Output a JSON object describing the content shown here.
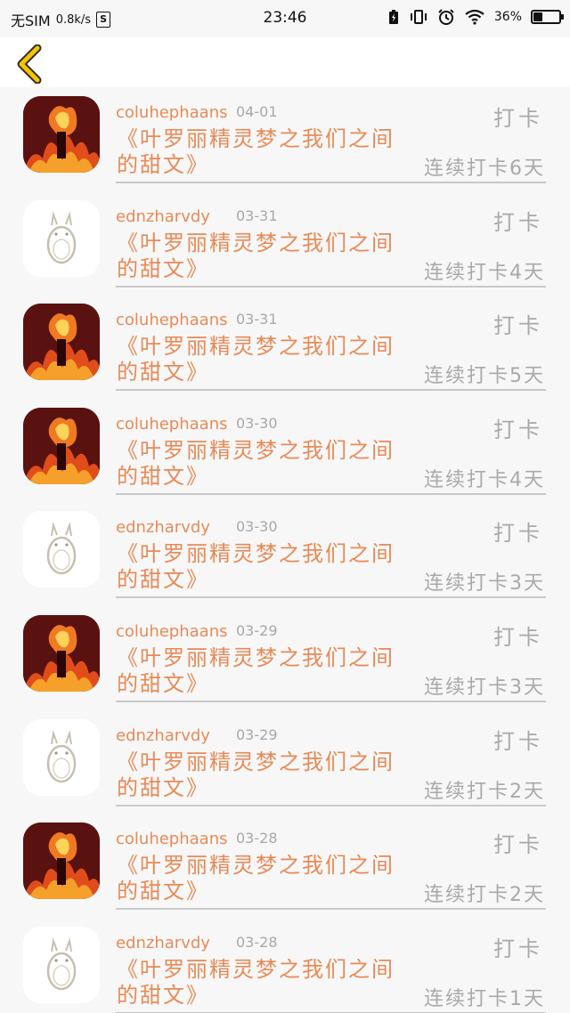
{
  "status_bar": {
    "carrier": "无SIM",
    "net_speed": "0.8k/s",
    "sim_badge": "S",
    "time": "23:46",
    "battery_text": "36%",
    "battery_level": 0.36
  },
  "nav": {
    "back_icon": "chevron-left-icon"
  },
  "feed": [
    {
      "avatar": "fire",
      "user": "coluhephaans",
      "date": "04-01",
      "title": "《叶罗丽精灵梦之我们之间的甜文》",
      "action": "打卡",
      "streak": "连续打卡6天"
    },
    {
      "avatar": "totoro",
      "user": "ednzharvdy",
      "date": "03-31",
      "title": "《叶罗丽精灵梦之我们之间的甜文》",
      "action": "打卡",
      "streak": "连续打卡4天"
    },
    {
      "avatar": "fire",
      "user": "coluhephaans",
      "date": "03-31",
      "title": "《叶罗丽精灵梦之我们之间的甜文》",
      "action": "打卡",
      "streak": "连续打卡5天"
    },
    {
      "avatar": "fire",
      "user": "coluhephaans",
      "date": "03-30",
      "title": "《叶罗丽精灵梦之我们之间的甜文》",
      "action": "打卡",
      "streak": "连续打卡4天"
    },
    {
      "avatar": "totoro",
      "user": "ednzharvdy",
      "date": "03-30",
      "title": "《叶罗丽精灵梦之我们之间的甜文》",
      "action": "打卡",
      "streak": "连续打卡3天"
    },
    {
      "avatar": "fire",
      "user": "coluhephaans",
      "date": "03-29",
      "title": "《叶罗丽精灵梦之我们之间的甜文》",
      "action": "打卡",
      "streak": "连续打卡3天"
    },
    {
      "avatar": "totoro",
      "user": "ednzharvdy",
      "date": "03-29",
      "title": "《叶罗丽精灵梦之我们之间的甜文》",
      "action": "打卡",
      "streak": "连续打卡2天"
    },
    {
      "avatar": "fire",
      "user": "coluhephaans",
      "date": "03-28",
      "title": "《叶罗丽精灵梦之我们之间的甜文》",
      "action": "打卡",
      "streak": "连续打卡2天"
    },
    {
      "avatar": "totoro",
      "user": "ednzharvdy",
      "date": "03-28",
      "title": "《叶罗丽精灵梦之我们之间的甜文》",
      "action": "打卡",
      "streak": "连续打卡1天"
    }
  ],
  "colors": {
    "accent": "#e98a57",
    "muted": "#a9a9a9",
    "back_icon": "#f4c400"
  }
}
